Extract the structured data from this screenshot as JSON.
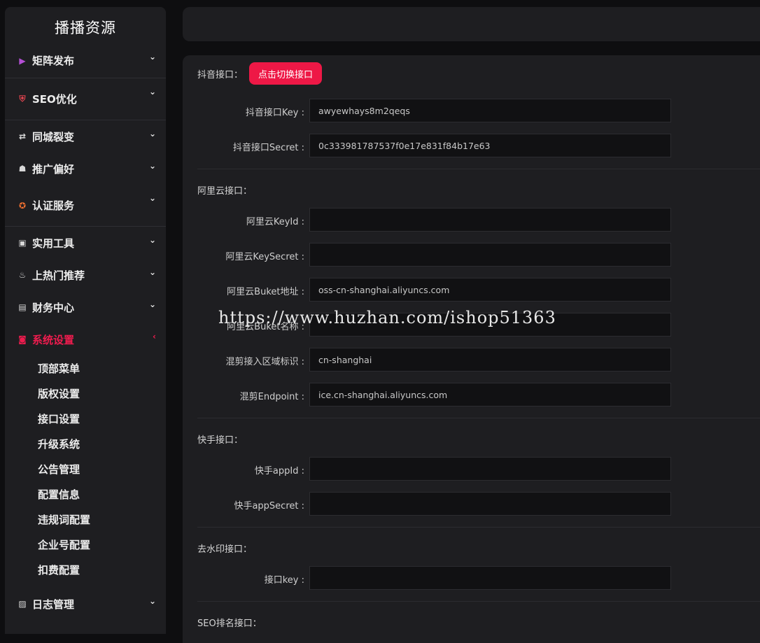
{
  "sidebar": {
    "brand": "播播资源",
    "items": [
      {
        "label": "矩阵发布",
        "icon": "video-icon",
        "glyph": "▶",
        "color": "#b54fd6"
      },
      {
        "label": "SEO优化",
        "icon": "shield-icon",
        "glyph": "⛨",
        "color": "#e0444f"
      },
      {
        "label": "同城裂变",
        "icon": "swap-icon",
        "glyph": "⇄",
        "color": "#d8d8d8"
      },
      {
        "label": "推广偏好",
        "icon": "robot-icon",
        "glyph": "☗",
        "color": "#d8d8d8"
      },
      {
        "label": "认证服务",
        "icon": "badge-icon",
        "glyph": "✪",
        "color": "#f07030"
      },
      {
        "label": "实用工具",
        "icon": "toolbox-icon",
        "glyph": "▣",
        "color": "#d8d8d8"
      },
      {
        "label": "上热门推荐",
        "icon": "fire-icon",
        "glyph": "♨",
        "color": "#d8d8d8"
      },
      {
        "label": "财务中心",
        "icon": "wallet-icon",
        "glyph": "▤",
        "color": "#d8d8d8"
      },
      {
        "label": "系统设置",
        "icon": "settings-icon",
        "glyph": "◙",
        "color": "#ee1c4e"
      },
      {
        "label": "日志管理",
        "icon": "log-icon",
        "glyph": "▨",
        "color": "#d8d8d8"
      }
    ],
    "sub_items": [
      "顶部菜单",
      "版权设置",
      "接口设置",
      "升级系统",
      "公告管理",
      "配置信息",
      "违规词配置",
      "企业号配置",
      "扣费配置"
    ]
  },
  "form": {
    "douyin": {
      "title": "抖音接口：",
      "switch_button": "点击切换接口",
      "key_label": "抖音接口Key :",
      "key_value": "awyewhays8m2qeqs",
      "secret_label": "抖音接口Secret :",
      "secret_value": "0c333981787537f0e17e831f84b17e63"
    },
    "aliyun": {
      "title": "阿里云接口：",
      "keyid_label": "阿里云KeyId :",
      "keyid_value": "",
      "keysecret_label": "阿里云KeySecret :",
      "keysecret_value": "",
      "bucket_addr_label": "阿里云Buket地址 :",
      "bucket_addr_value": "oss-cn-shanghai.aliyuncs.com",
      "bucket_name_label": "阿里云Buket名称 :",
      "bucket_name_value": "",
      "region_label": "混剪接入区域标识 :",
      "region_value": "cn-shanghai",
      "endpoint_label": "混剪Endpoint :",
      "endpoint_value": "ice.cn-shanghai.aliyuncs.com"
    },
    "kuaishou": {
      "title": "快手接口：",
      "appid_label": "快手appId :",
      "appid_value": "",
      "appsecret_label": "快手appSecret :",
      "appsecret_value": ""
    },
    "watermark_api": {
      "title": "去水印接口：",
      "key_label": "接口key :",
      "key_value": ""
    },
    "seo_rank": {
      "title": "SEO排名接口："
    }
  },
  "overlay": {
    "watermark_text": "https://www.huzhan.com/ishop51363"
  },
  "colors": {
    "accent": "#ee1846",
    "panel": "#1e1e21",
    "background": "#0e0e10"
  }
}
